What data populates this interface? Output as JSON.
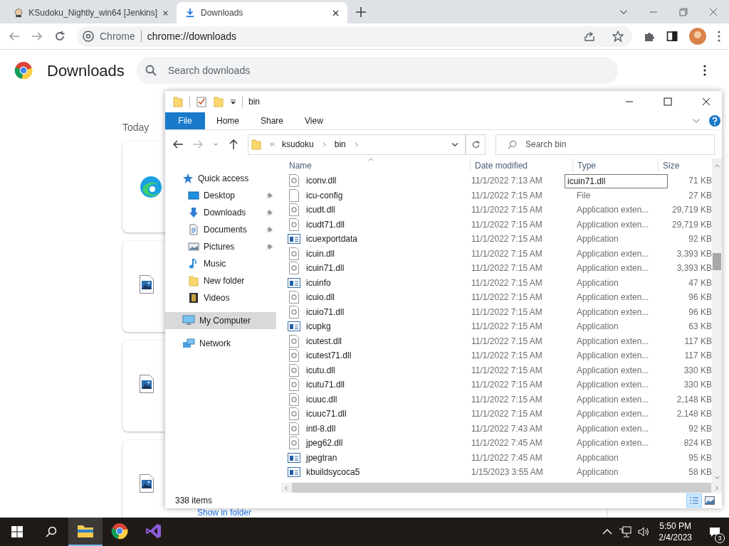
{
  "browser": {
    "tabs": [
      {
        "title": "KSudoku_Nightly_win64 [Jenkins]",
        "kind": "jenkins",
        "selected": false
      },
      {
        "title": "Downloads",
        "kind": "download",
        "selected": true
      }
    ],
    "omnibox": {
      "site_label": "Chrome",
      "url": "chrome://downloads"
    }
  },
  "downloads_page": {
    "title": "Downloads",
    "search_placeholder": "Search downloads",
    "section": "Today",
    "cards": [
      {
        "kind": "edge"
      },
      {
        "kind": "image"
      },
      {
        "kind": "image"
      },
      {
        "kind": "image"
      }
    ],
    "link": "Show in folder"
  },
  "explorer": {
    "title": "bin",
    "ribbon_tabs": [
      {
        "label": "File",
        "kind": "menu"
      },
      {
        "label": "Home",
        "kind": "tab"
      },
      {
        "label": "Share",
        "kind": "tab"
      },
      {
        "label": "View",
        "kind": "tab"
      }
    ],
    "breadcrumb": [
      "ksudoku",
      "bin"
    ],
    "search_placeholder": "Search bin",
    "nav": [
      {
        "label": "Quick access",
        "kind": "star",
        "selected": false,
        "children": [
          {
            "label": "Desktop",
            "kind": "desktop",
            "pinned": true,
            "selected": false
          },
          {
            "label": "Downloads",
            "kind": "downloads",
            "pinned": true,
            "selected": false
          },
          {
            "label": "Documents",
            "kind": "documents",
            "pinned": true,
            "selected": false
          },
          {
            "label": "Pictures",
            "kind": "pictures",
            "pinned": true,
            "selected": false
          },
          {
            "label": "Music",
            "kind": "music",
            "pinned": false,
            "selected": false
          },
          {
            "label": "New folder",
            "kind": "folder",
            "pinned": false,
            "selected": false
          },
          {
            "label": "Videos",
            "kind": "videos",
            "pinned": false,
            "selected": false
          }
        ]
      },
      {
        "label": "My Computer",
        "kind": "computer",
        "selected": true
      },
      {
        "label": "Network",
        "kind": "network",
        "selected": false
      }
    ],
    "columns": [
      "Name",
      "Date modified",
      "Type",
      "Size"
    ],
    "rows": [
      {
        "name": "iconv.dll",
        "date": "11/1/2022 7:13 AM",
        "size": "71 KB",
        "kind": "dll"
      },
      {
        "name": "icu-config",
        "date": "11/1/2022 7:15 AM",
        "type": "File",
        "size": "27 KB",
        "kind": "file"
      },
      {
        "name": "icudt.dll",
        "date": "11/1/2022 7:15 AM",
        "type": "Application exten...",
        "size": "29,719 KB",
        "kind": "dll"
      },
      {
        "name": "icudt71.dll",
        "date": "11/1/2022 7:15 AM",
        "type": "Application exten...",
        "size": "29,719 KB",
        "kind": "dll"
      },
      {
        "name": "icuexportdata",
        "date": "11/1/2022 7:15 AM",
        "type": "Application",
        "size": "92 KB",
        "kind": "exe"
      },
      {
        "name": "icuin.dll",
        "date": "11/1/2022 7:15 AM",
        "type": "Application exten...",
        "size": "3,393 KB",
        "kind": "dll"
      },
      {
        "name": "icuin71.dll",
        "date": "11/1/2022 7:15 AM",
        "type": "Application exten...",
        "size": "3,393 KB",
        "kind": "dll"
      },
      {
        "name": "icuinfo",
        "date": "11/1/2022 7:15 AM",
        "type": "Application",
        "size": "47 KB",
        "kind": "exe"
      },
      {
        "name": "icuio.dll",
        "date": "11/1/2022 7:15 AM",
        "type": "Application exten...",
        "size": "96 KB",
        "kind": "dll"
      },
      {
        "name": "icuio71.dll",
        "date": "11/1/2022 7:15 AM",
        "type": "Application exten...",
        "size": "96 KB",
        "kind": "dll"
      },
      {
        "name": "icupkg",
        "date": "11/1/2022 7:15 AM",
        "type": "Application",
        "size": "63 KB",
        "kind": "exe"
      },
      {
        "name": "icutest.dll",
        "date": "11/1/2022 7:15 AM",
        "type": "Application exten...",
        "size": "117 KB",
        "kind": "dll"
      },
      {
        "name": "icutest71.dll",
        "date": "11/1/2022 7:15 AM",
        "type": "Application exten...",
        "size": "117 KB",
        "kind": "dll"
      },
      {
        "name": "icutu.dll",
        "date": "11/1/2022 7:15 AM",
        "type": "Application exten...",
        "size": "330 KB",
        "kind": "dll"
      },
      {
        "name": "icutu71.dll",
        "date": "11/1/2022 7:15 AM",
        "type": "Application exten...",
        "size": "330 KB",
        "kind": "dll"
      },
      {
        "name": "icuuc.dll",
        "date": "11/1/2022 7:15 AM",
        "type": "Application exten...",
        "size": "2,148 KB",
        "kind": "dll"
      },
      {
        "name": "icuuc71.dll",
        "date": "11/1/2022 7:15 AM",
        "type": "Application exten...",
        "size": "2,148 KB",
        "kind": "dll"
      },
      {
        "name": "intl-8.dll",
        "date": "11/1/2022 7:43 AM",
        "type": "Application exten...",
        "size": "92 KB",
        "kind": "dll"
      },
      {
        "name": "jpeg62.dll",
        "date": "11/1/2022 7:45 AM",
        "type": "Application exten...",
        "size": "824 KB",
        "kind": "dll"
      },
      {
        "name": "jpegtran",
        "date": "11/1/2022 7:45 AM",
        "type": "Application",
        "size": "95 KB",
        "kind": "exe"
      },
      {
        "name": "kbuildsycoca5",
        "date": "1/15/2023 3:55 AM",
        "type": "Application",
        "size": "58 KB",
        "kind": "exe"
      }
    ],
    "tooltip": "icuin71.dll",
    "status": "338 items"
  },
  "taskbar": {
    "apps": [
      {
        "kind": "explorer",
        "active": true
      },
      {
        "kind": "chrome",
        "active": false
      },
      {
        "kind": "visualstudio",
        "active": false
      }
    ],
    "time": "5:50 PM",
    "date": "2/4/2023",
    "notifications": "3"
  }
}
